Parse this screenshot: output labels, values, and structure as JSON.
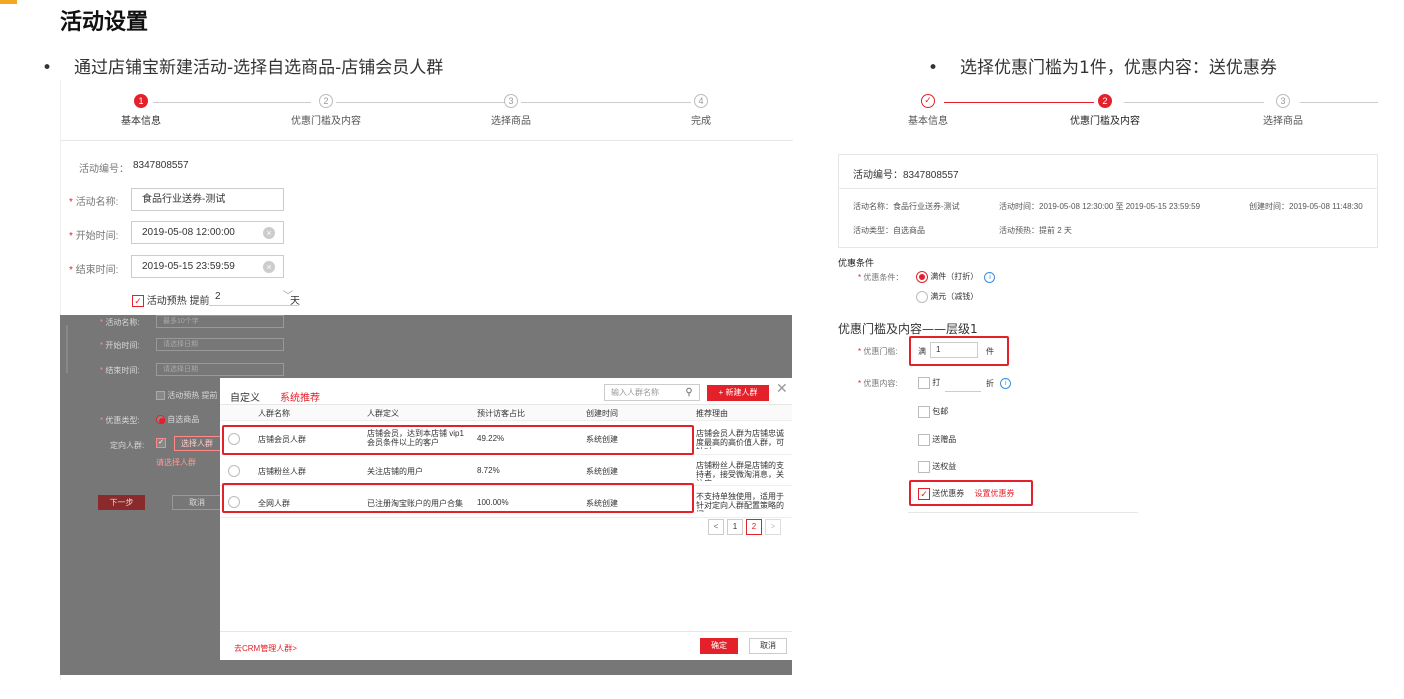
{
  "page_title": "活动设置",
  "bullet_left": "通过店铺宝新建活动-选择自选商品-店铺会员人群",
  "bullet_right": "选择优惠门槛为1件，优惠内容：送优惠券",
  "left": {
    "steps": [
      {
        "num": "1",
        "label": "基本信息"
      },
      {
        "num": "2",
        "label": "优惠门槛及内容"
      },
      {
        "num": "3",
        "label": "选择商品"
      },
      {
        "num": "4",
        "label": "完成"
      }
    ],
    "activity_id_label": "活动编号：",
    "activity_id": "8347808557",
    "name_label": "活动名称:",
    "name_value": "食品行业送券-测试",
    "start_label": "开始时间:",
    "start_value": "2019-05-08 12:00:00",
    "end_label": "结束时间:",
    "end_value": "2019-05-15 23:59:59",
    "preheat_label": "活动预热",
    "preheat_prefix": "提前",
    "preheat_value": "2",
    "preheat_unit": "天"
  },
  "overlay": {
    "name_label": "活动名称:",
    "name_ph": "最多10个字",
    "start_label": "开始时间:",
    "start_ph": "请选择日期",
    "end_label": "结束时间:",
    "end_ph": "请选择日期",
    "preheat": "活动预热 提前",
    "type_label": "优惠类型:",
    "type_value": "自选商品",
    "crowd_label": "定向人群:",
    "crowd_btn": "选择人群",
    "crowd_hint": "请选择人群",
    "next": "下一步",
    "cancel": "取消"
  },
  "modal": {
    "tab_custom": "自定义",
    "tab_system": "系统推荐",
    "search_ph": "输入人群名称",
    "new_btn": "+ 新建人群",
    "headers": [
      "人群名称",
      "人群定义",
      "预计访客占比",
      "创建时间",
      "推荐理由"
    ],
    "rows": [
      {
        "name": "店铺会员人群",
        "def": "店铺会员，达到本店铺 vip1 会员条件以上的客户",
        "ratio": "49.22%",
        "created": "系统创建",
        "reason": "店铺会员人群为店铺忠诚度最高的高价值人群，可针对..."
      },
      {
        "name": "店铺粉丝人群",
        "def": "关注店铺的用户",
        "ratio": "8.72%",
        "created": "系统创建",
        "reason": "店铺粉丝人群是店铺的支持者，接受微淘消息，关注店..."
      },
      {
        "name": "全网人群",
        "def": "已注册淘宝账户的用户合集",
        "ratio": "100.00%",
        "created": "系统创建",
        "reason": "不支持单独使用，适用于针对定向人群配置策略的间..."
      }
    ],
    "pages": [
      "<",
      "1",
      "2",
      ">"
    ],
    "crm_link": "去CRM管理人群>",
    "confirm": "确定",
    "cancel": "取消"
  },
  "right": {
    "steps": [
      {
        "num": "✓",
        "label": "基本信息"
      },
      {
        "num": "2",
        "label": "优惠门槛及内容"
      },
      {
        "num": "3",
        "label": "选择商品"
      }
    ],
    "activity_id_label": "活动编号：",
    "activity_id": "8347808557",
    "info_name": "活动名称：食品行业送券-测试",
    "info_time": "活动时间：2019-05-08 12:30:00 至 2019-05-15 23:59:59",
    "info_created": "创建时间：2019-05-08 11:48:30",
    "info_type": "活动类型：自选商品",
    "info_preheat": "活动预热：提前 2 天",
    "cond_title": "优惠条件",
    "cond_label": "优惠条件：",
    "cond_opt1": "满件（打折）",
    "cond_opt2": "满元（减钱）",
    "level_title": "优惠门槛及内容——层级1",
    "threshold_label": "优惠门槛:",
    "threshold_prefix": "满",
    "threshold_value": "1",
    "threshold_unit": "件",
    "content_label": "优惠内容:",
    "opt_discount": "打",
    "opt_discount_unit": "折",
    "opt_shipping": "包邮",
    "opt_gift": "送赠品",
    "opt_rights": "送权益",
    "opt_coupon": "送优惠券",
    "set_coupon": "设置优惠券"
  },
  "colors": {
    "accent": "#e4202a",
    "orange": "#f5a623"
  }
}
